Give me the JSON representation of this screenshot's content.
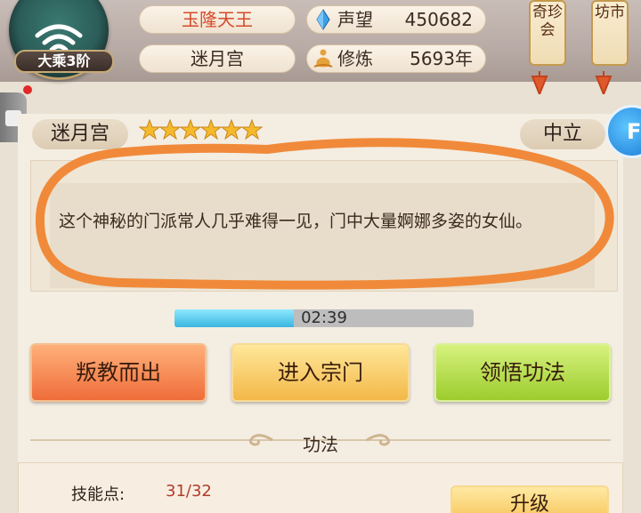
{
  "header": {
    "realm_badge": "大乘3阶",
    "player_name": "玉隆天王",
    "sect_name": "迷月宫",
    "reputation_label": "声望",
    "reputation_value": "450682",
    "cultivation_label": "修炼",
    "cultivation_value": "5693年",
    "lanterns": [
      {
        "label": "奇珍会"
      },
      {
        "label": "坊市"
      }
    ]
  },
  "side_button_letter": "F",
  "sect": {
    "title": "迷月宫",
    "stars": 6,
    "alignment": "中立",
    "description": "这个神秘的门派常人几乎难得一见，门中大量婀娜多姿的女仙。",
    "timer": "02:39",
    "timer_progress": 0.4
  },
  "actions": {
    "leave_label": "叛教而出",
    "enter_label": "进入宗门",
    "learn_label": "领悟功法"
  },
  "skills": {
    "section_title": "功法",
    "points_label": "技能点:",
    "points_value": "31/32",
    "upgrade_label": "升级"
  },
  "colors": {
    "accent_name": "#d64a2a",
    "annotation": "#f08a3a",
    "timer_fill": "#39b6df"
  }
}
